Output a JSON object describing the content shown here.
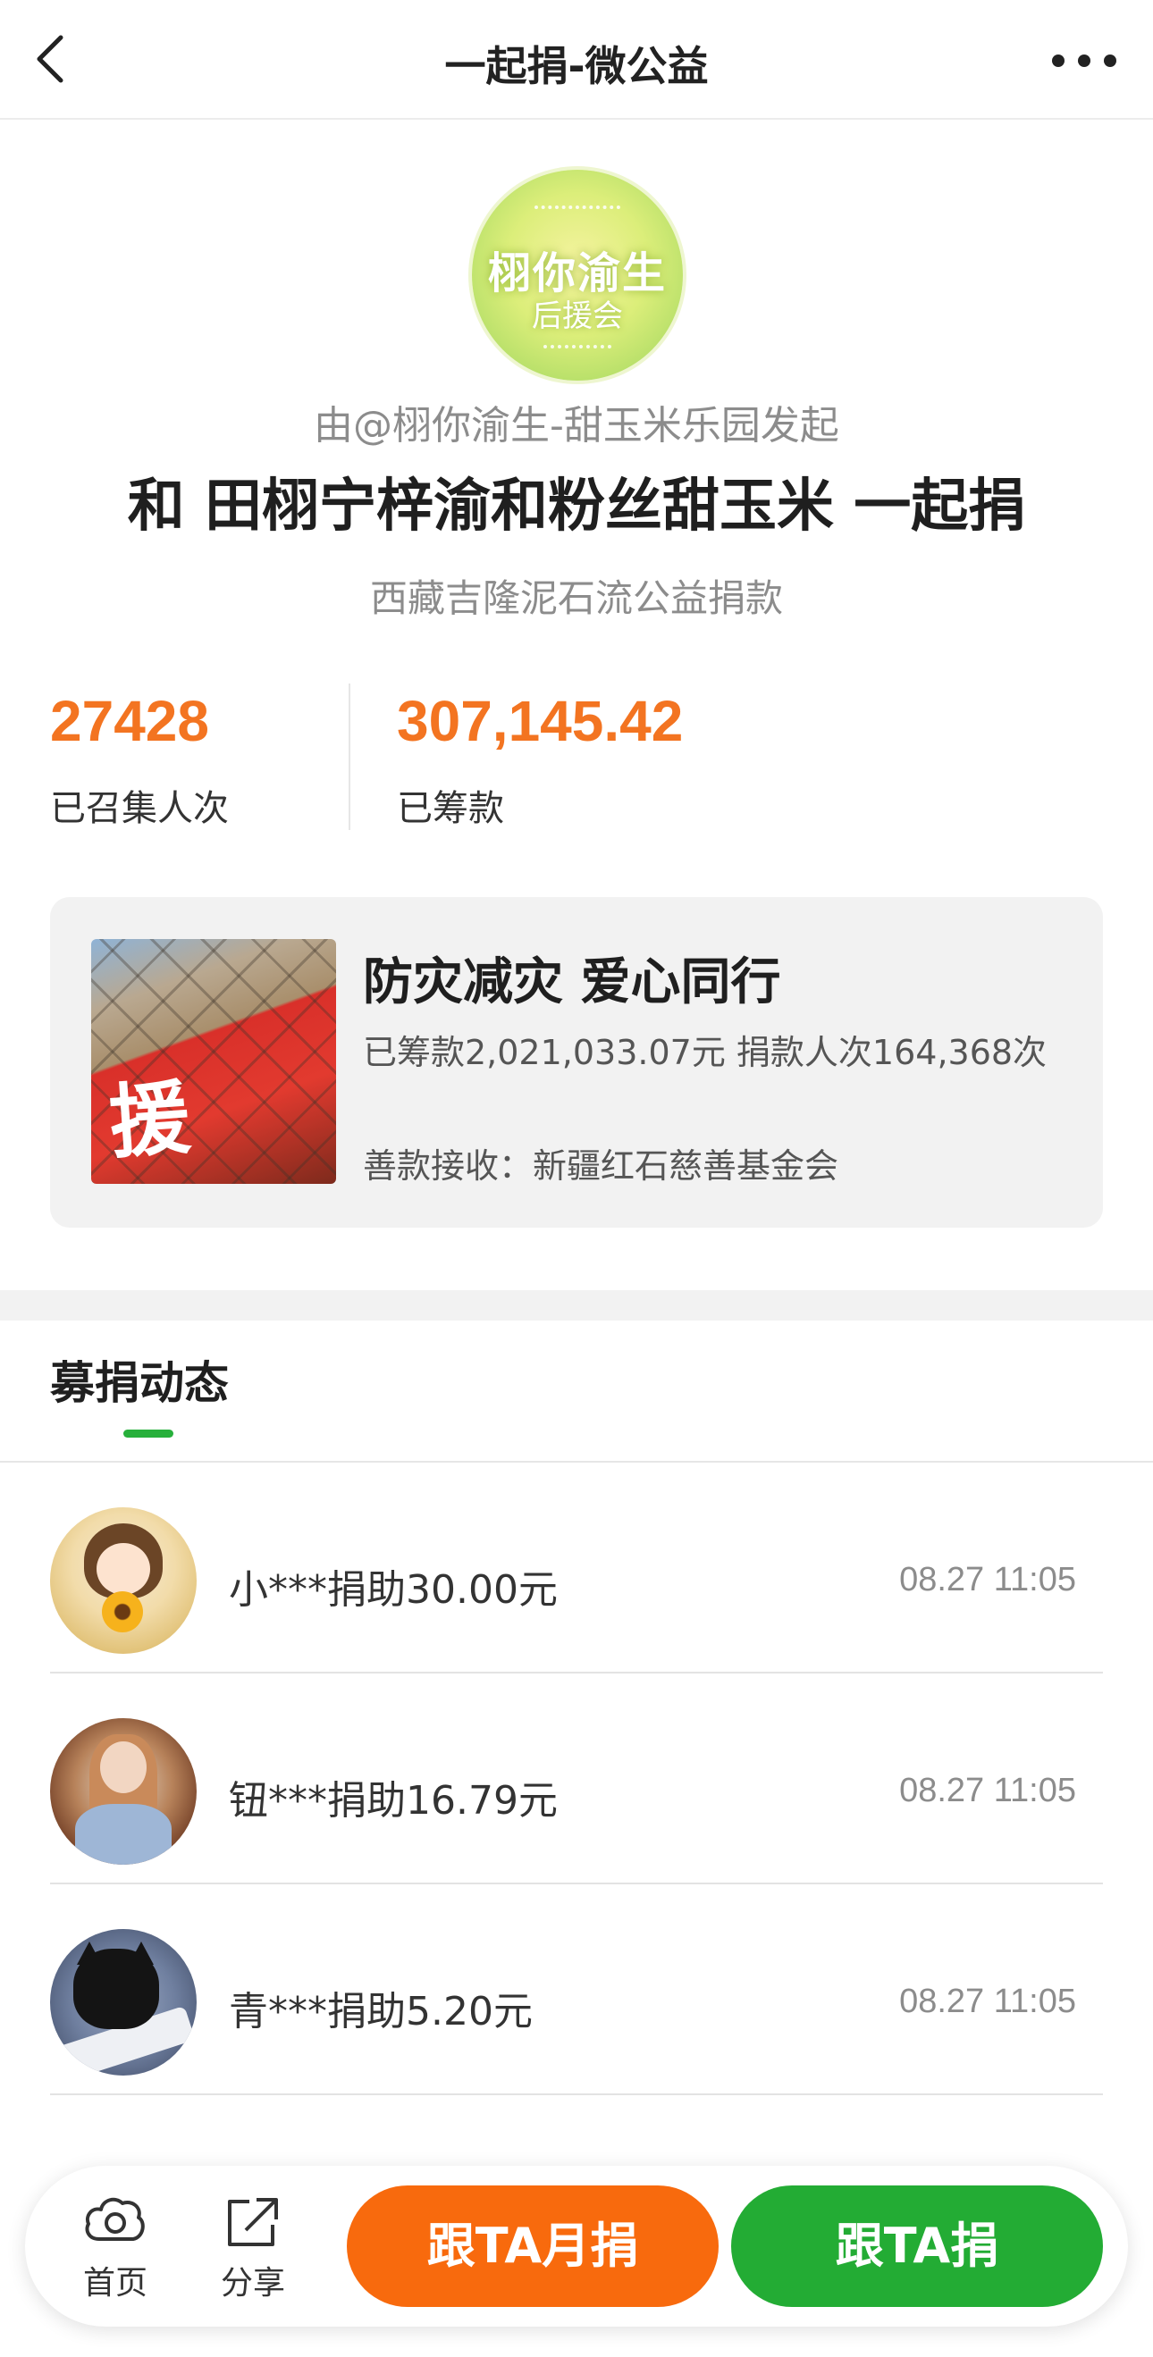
{
  "nav": {
    "title": "一起捐-微公益",
    "back_icon": "chevron-left-icon",
    "more_icon": "more-horizontal-icon"
  },
  "campaign": {
    "logo": {
      "line1": "栩你渝生",
      "line2": "后援会"
    },
    "initiator": "由@栩你渝生-甜玉米乐园发起",
    "headline": "和 田栩宁梓渝和粉丝甜玉米 一起捐",
    "subheadline": "西藏吉隆泥石流公益捐款"
  },
  "stats": [
    {
      "value": "27428",
      "label": "已召集人次"
    },
    {
      "value": "307,145.42",
      "label": "已筹款"
    }
  ],
  "project": {
    "image_text": "援",
    "title": "防灾减灾 爱心同行",
    "stats_text": "已筹款2,021,033.07元  捐款人次164,368次",
    "receiver": "善款接收：新疆红石慈善基金会"
  },
  "tab": {
    "label": "募捐动态"
  },
  "donations": [
    {
      "text": "小***捐助30.00元",
      "time": "08.27 11:05"
    },
    {
      "text": "钮***捐助16.79元",
      "time": "08.27 11:05"
    },
    {
      "text": "青***捐助5.20元",
      "time": "08.27 11:05"
    }
  ],
  "bottom": {
    "home_label": "首页",
    "share_label": "分享",
    "monthly_label": "跟TA月捐",
    "donate_label": "跟TA捐"
  },
  "colors": {
    "accent_orange": "#f37421",
    "monthly_button": "#f86a0d",
    "donate_button": "#23ac34",
    "tab_indicator": "#27b03b"
  }
}
